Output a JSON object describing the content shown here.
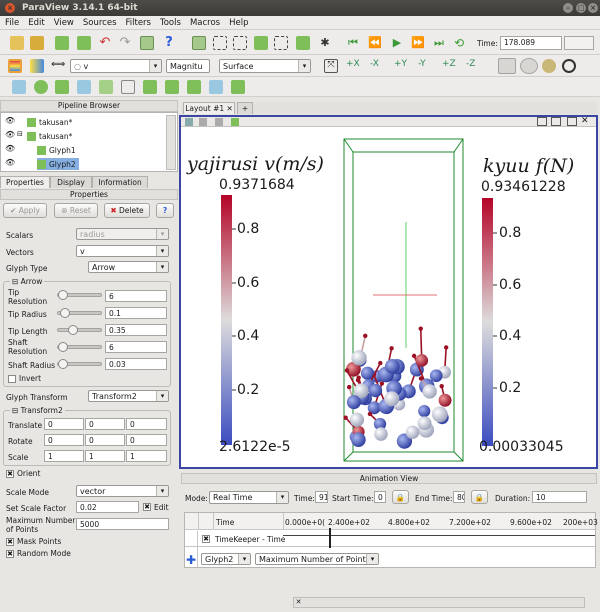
{
  "window": {
    "title": "ParaView 3.14.1 64-bit"
  },
  "menu": [
    "File",
    "Edit",
    "View",
    "Sources",
    "Filters",
    "Tools",
    "Macros",
    "Help"
  ],
  "toolbar": {
    "time_label": "Time:",
    "time_value": "178.089",
    "time_index": "",
    "array_combo": "v",
    "component_combo": "Magnitu",
    "representation_combo": "Surface"
  },
  "pipeline": {
    "title": "Pipeline Browser",
    "items": [
      "takusan*",
      "takusan*",
      "Glyph1",
      "Glyph2"
    ]
  },
  "tabs": {
    "properties": "Properties",
    "display": "Display",
    "information": "Information"
  },
  "properties": {
    "header": "Properties",
    "apply": "Apply",
    "reset": "Reset",
    "delete": "Delete",
    "help": "?",
    "scalars_label": "Scalars",
    "scalars_value": "radius",
    "vectors_label": "Vectors",
    "vectors_value": "v",
    "glyph_type_label": "Glyph Type",
    "glyph_type_value": "Arrow",
    "arrow_group": "Arrow",
    "tip_resolution_label": "Tip Resolution",
    "tip_resolution": "6",
    "tip_radius_label": "Tip Radius",
    "tip_radius": "0.1",
    "tip_length_label": "Tip Length",
    "tip_length": "0.35",
    "shaft_resolution_label": "Shaft Resolution",
    "shaft_resolution": "6",
    "shaft_radius_label": "Shaft Radius",
    "shaft_radius": "0.03",
    "invert_label": "Invert",
    "glyph_transform_label": "Glyph Transform",
    "glyph_transform_value": "Transform2",
    "transform_group": "Transform2",
    "translate_label": "Translate",
    "translate": [
      "0",
      "0",
      "0"
    ],
    "rotate_label": "Rotate",
    "rotate": [
      "0",
      "0",
      "0"
    ],
    "scale_label": "Scale",
    "scale": [
      "1",
      "1",
      "1"
    ],
    "orient_label": "Orient",
    "scale_mode_label": "Scale Mode",
    "scale_mode_value": "vector",
    "set_scale_factor_label": "Set Scale Factor",
    "scale_factor": "0.02",
    "edit_label": "Edit",
    "max_points_label": "Maximum Number of Points",
    "max_points": "5000",
    "mask_points_label": "Mask Points",
    "random_mode_label": "Random Mode"
  },
  "layout": {
    "tab": "Layout #1",
    "add": "+"
  },
  "legend_left": {
    "title": "yajirusi v(m/s)",
    "max": "0.9371684",
    "ticks": [
      "0.8",
      "0.6",
      "0.4",
      "0.2"
    ],
    "min": "2.6122e-5"
  },
  "legend_right": {
    "title": "kyuu f(N)",
    "max": "0.93461228",
    "ticks": [
      "0.8",
      "0.6",
      "0.4",
      "0.2"
    ],
    "min": "0.00033045"
  },
  "animation": {
    "title": "Animation View",
    "mode_label": "Mode:",
    "mode_value": "Real Time",
    "time_label": "Time:",
    "time_value": "91",
    "start_label": "Start Time:",
    "start_value": "0",
    "end_label": "End Time:",
    "end_value": "80",
    "duration_label": "Duration:",
    "duration_value": "10",
    "time_header": "Time",
    "ticks": [
      "0.000e+0(",
      "2.400e+02",
      "4.800e+02",
      "7.200e+02",
      "9.600e+02",
      "200e+03"
    ],
    "timekeeper": "TimeKeeper - Time",
    "source_value": "Glyph2",
    "property_value": "Maximum Number of Points"
  },
  "colors": {
    "accent": "#3b46a3",
    "selection": "#86b0e2",
    "title_bg": "#3c3b37"
  }
}
